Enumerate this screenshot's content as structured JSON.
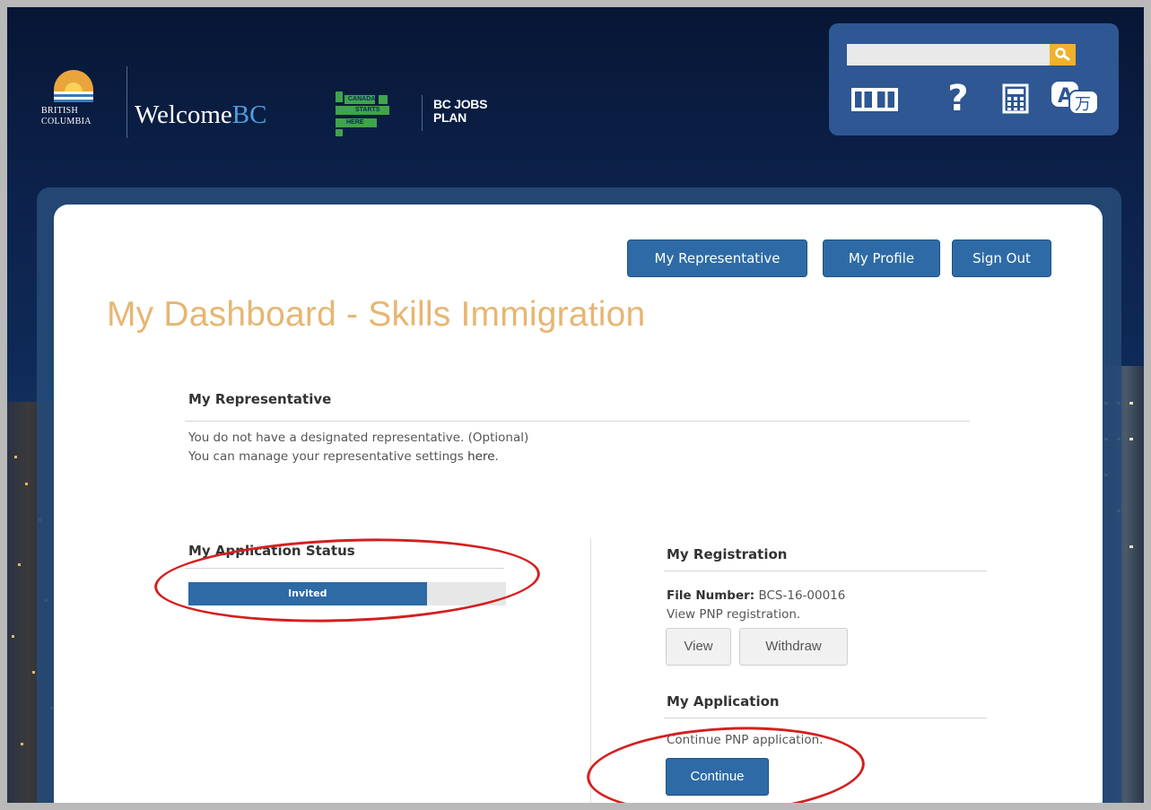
{
  "header": {
    "bc_logo_line1": "BRITISH",
    "bc_logo_line2": "COLUMBIA",
    "welcome_prefix": "Welcome",
    "welcome_suffix": "BC",
    "csh_line1": "CANADA",
    "csh_line2": "STARTS",
    "csh_line3": "HERE",
    "bcjobs_line1": "BC JOBS",
    "bcjobs_line2": "PLAN",
    "search_placeholder": "",
    "tool_icons": [
      "book-icon",
      "help-icon",
      "calculator-icon",
      "translate-icon"
    ]
  },
  "nav": {
    "representative": "My Representative",
    "profile": "My Profile",
    "signout": "Sign Out"
  },
  "page_title": "My Dashboard - Skills Immigration",
  "representative": {
    "heading": "My Representative",
    "line1": "You do not have a designated representative. (Optional)",
    "line2_prefix": "You can manage your representative settings ",
    "line2_link": "here",
    "line2_suffix": "."
  },
  "status": {
    "heading": "My Application Status",
    "progress_label": "Invited",
    "progress_fraction": 0.75
  },
  "registration": {
    "heading": "My Registration",
    "file_label": "File Number:",
    "file_value": " BCS-16-00016",
    "view_text": "View PNP registration.",
    "view_button": "View",
    "withdraw_button": "Withdraw"
  },
  "application": {
    "heading": "My Application",
    "text": "Continue PNP application.",
    "continue_button": "Continue"
  },
  "colors": {
    "accent": "#2e6ba6",
    "title": "#e7b672",
    "annotation": "#d41f1f"
  }
}
